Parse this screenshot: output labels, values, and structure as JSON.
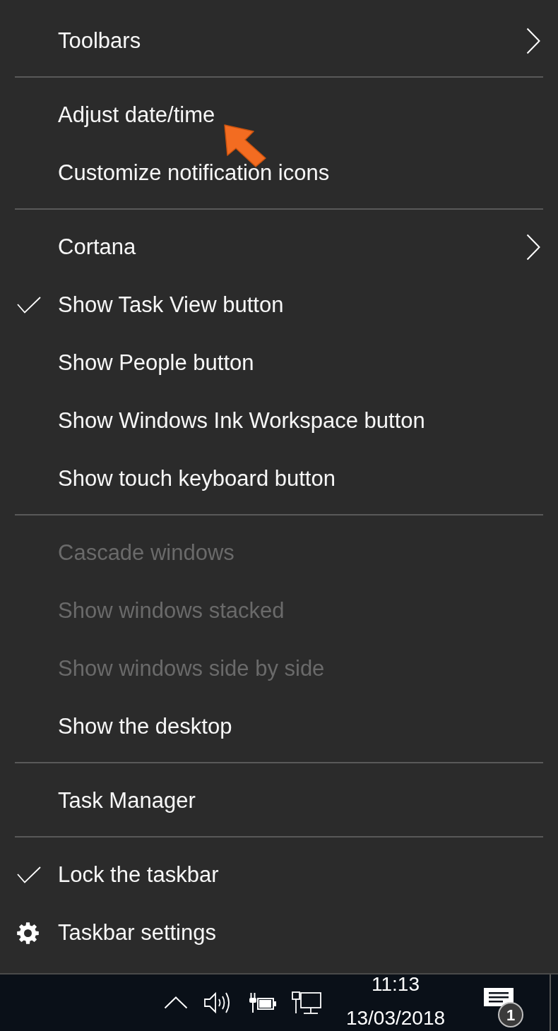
{
  "menu": {
    "items": [
      {
        "kind": "option",
        "label": "Toolbars",
        "checked": false,
        "disabled": false,
        "submenu": true
      },
      {
        "kind": "separator"
      },
      {
        "kind": "option",
        "label": "Adjust date/time",
        "checked": false,
        "disabled": false,
        "submenu": false
      },
      {
        "kind": "option",
        "label": "Customize notification icons",
        "checked": false,
        "disabled": false,
        "submenu": false
      },
      {
        "kind": "separator"
      },
      {
        "kind": "option",
        "label": "Cortana",
        "checked": false,
        "disabled": false,
        "submenu": true
      },
      {
        "kind": "option",
        "label": "Show Task View button",
        "checked": true,
        "disabled": false,
        "submenu": false
      },
      {
        "kind": "option",
        "label": "Show People button",
        "checked": false,
        "disabled": false,
        "submenu": false
      },
      {
        "kind": "option",
        "label": "Show Windows Ink Workspace button",
        "checked": false,
        "disabled": false,
        "submenu": false
      },
      {
        "kind": "option",
        "label": "Show touch keyboard button",
        "checked": false,
        "disabled": false,
        "submenu": false
      },
      {
        "kind": "separator"
      },
      {
        "kind": "option",
        "label": "Cascade windows",
        "checked": false,
        "disabled": true,
        "submenu": false
      },
      {
        "kind": "option",
        "label": "Show windows stacked",
        "checked": false,
        "disabled": true,
        "submenu": false
      },
      {
        "kind": "option",
        "label": "Show windows side by side",
        "checked": false,
        "disabled": true,
        "submenu": false
      },
      {
        "kind": "option",
        "label": "Show the desktop",
        "checked": false,
        "disabled": false,
        "submenu": false
      },
      {
        "kind": "separator"
      },
      {
        "kind": "option",
        "label": "Task Manager",
        "checked": false,
        "disabled": false,
        "submenu": false
      },
      {
        "kind": "separator"
      },
      {
        "kind": "option",
        "label": "Lock the taskbar",
        "checked": true,
        "disabled": false,
        "submenu": false
      },
      {
        "kind": "settings",
        "label": "Taskbar settings",
        "disabled": false,
        "submenu": false
      }
    ]
  },
  "taskbar": {
    "time": "11:13",
    "date": "13/03/2018",
    "notification_count": "1"
  }
}
